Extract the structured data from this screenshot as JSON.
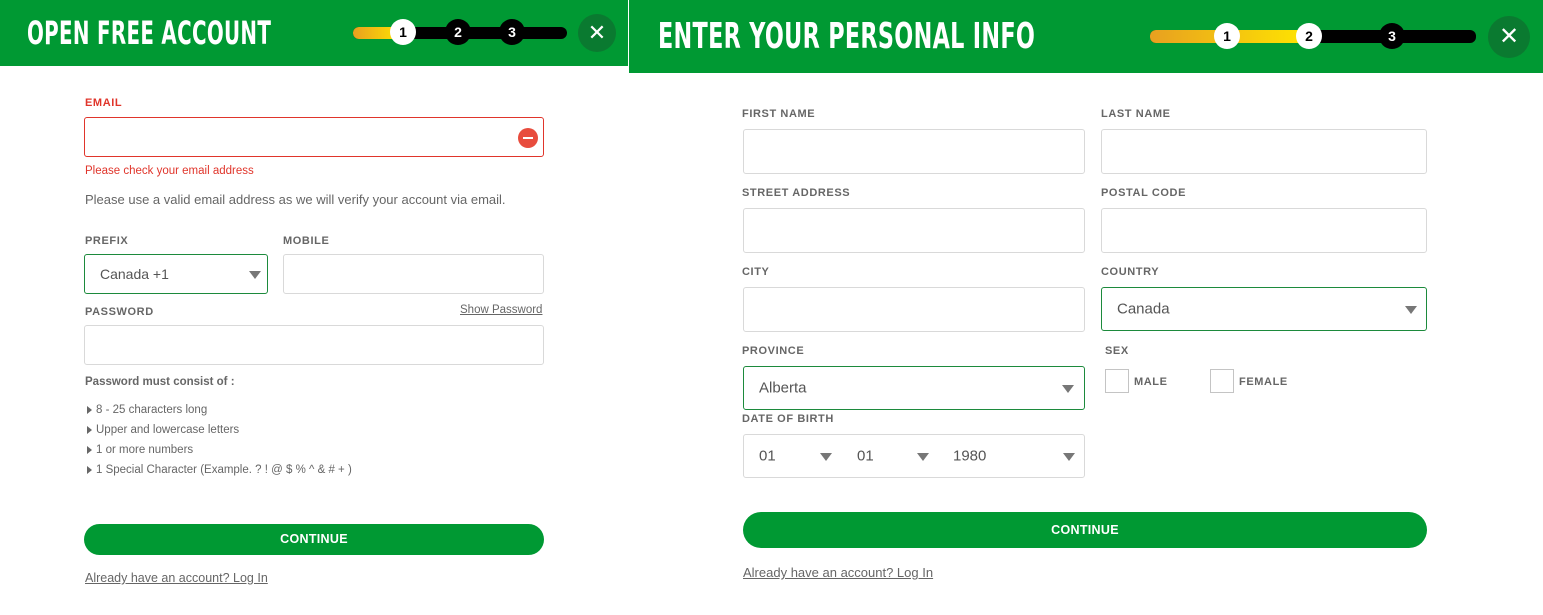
{
  "step1": {
    "title": "OPEN FREE ACCOUNT",
    "steps": [
      "1",
      "2",
      "3"
    ],
    "close_icon": "close-icon",
    "email": {
      "label": "EMAIL",
      "value": "",
      "error": "Please check your email address",
      "help": "Please use a valid email address as we will verify your account via email."
    },
    "prefix": {
      "label": "PREFIX",
      "value": "Canada +1"
    },
    "mobile": {
      "label": "MOBILE",
      "value": ""
    },
    "password": {
      "label": "PASSWORD",
      "show_label": "Show Password",
      "value": "",
      "rules_title": "Password must consist of :",
      "rules": [
        "8 - 25 characters long",
        "Upper and lowercase letters",
        "1 or more numbers",
        "1 Special Character (Example. ? ! @ $ % ^ & # + )"
      ]
    },
    "continue_label": "CONTINUE",
    "login_link": "Already have an account? Log In"
  },
  "step2": {
    "title": "ENTER YOUR PERSONAL INFO",
    "steps": [
      "1",
      "2",
      "3"
    ],
    "close_icon": "close-icon",
    "first_name": {
      "label": "FIRST NAME",
      "value": ""
    },
    "last_name": {
      "label": "LAST NAME",
      "value": ""
    },
    "street": {
      "label": "STREET ADDRESS",
      "value": ""
    },
    "postal": {
      "label": "POSTAL CODE",
      "value": ""
    },
    "city": {
      "label": "CITY",
      "value": ""
    },
    "country": {
      "label": "COUNTRY",
      "value": "Canada"
    },
    "province": {
      "label": "PROVINCE",
      "value": "Alberta"
    },
    "sex": {
      "label": "SEX",
      "options": [
        "MALE",
        "FEMALE"
      ]
    },
    "dob": {
      "label": "DATE OF BIRTH",
      "day": "01",
      "month": "01",
      "year": "1980"
    },
    "continue_label": "CONTINUE",
    "login_link": "Already have an account? Log In"
  },
  "colors": {
    "brand_green": "#009933",
    "error_red": "#e0352b",
    "progress_start": "#e8a020",
    "progress_end": "#ffe600"
  }
}
